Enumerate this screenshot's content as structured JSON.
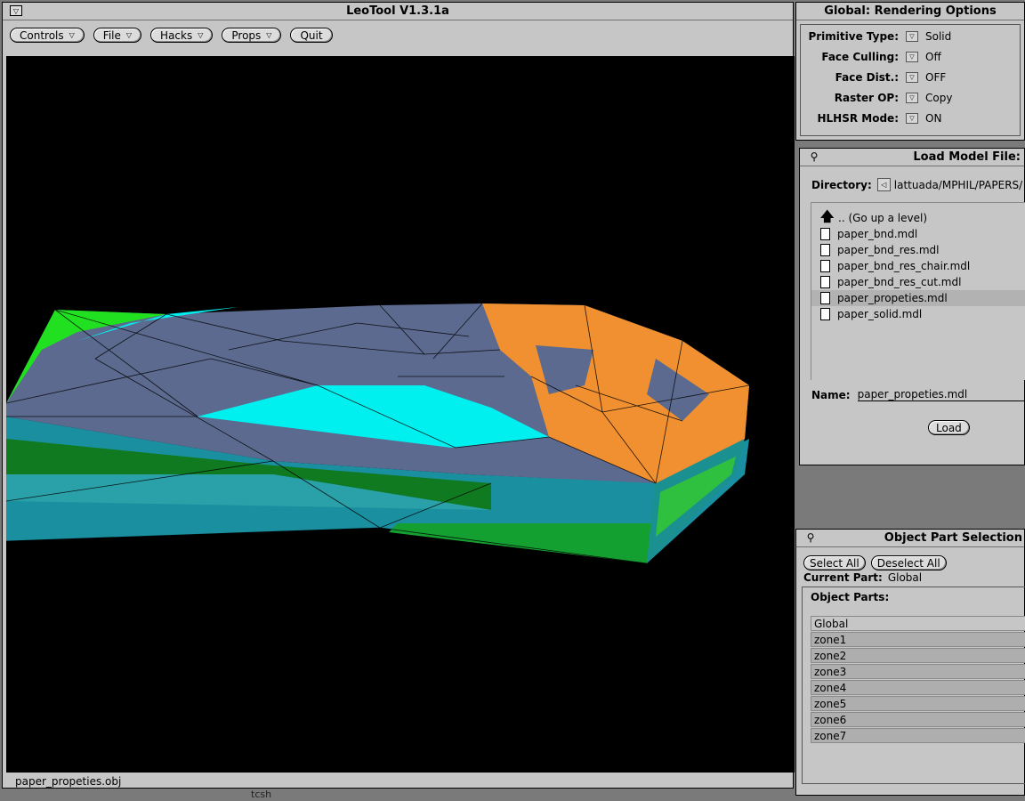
{
  "main_window": {
    "title": "LeoTool V1.3.1a",
    "menus": [
      {
        "label": "Controls",
        "has_menu": true
      },
      {
        "label": "File",
        "has_menu": true
      },
      {
        "label": "Hacks",
        "has_menu": true
      },
      {
        "label": "Props",
        "has_menu": true
      },
      {
        "label": "Quit",
        "has_menu": false
      }
    ],
    "status_text": "paper_propeties.obj"
  },
  "rendering_options": {
    "title": "Global: Rendering Options",
    "options": [
      {
        "label": "Primitive Type:",
        "value": "Solid"
      },
      {
        "label": "Face Culling:",
        "value": "Off"
      },
      {
        "label": "Face Dist.:",
        "value": "OFF"
      },
      {
        "label": "Raster OP:",
        "value": "Copy"
      },
      {
        "label": "HLHSR Mode:",
        "value": "ON"
      }
    ]
  },
  "load_model": {
    "title": "Load Model File:",
    "directory_label": "Directory:",
    "directory_value": "lattuada/MPHIL/PAPERS/",
    "up_level_label": ".. (Go up a level)",
    "files": [
      "paper_bnd.mdl",
      "paper_bnd_res.mdl",
      "paper_bnd_res_chair.mdl",
      "paper_bnd_res_cut.mdl",
      "paper_propeties.mdl",
      "paper_solid.mdl"
    ],
    "selected_file": "paper_propeties.mdl",
    "name_label": "Name:",
    "name_value": "paper_propeties.mdl",
    "load_button": "Load"
  },
  "object_parts": {
    "title": "Object Part Selection",
    "select_all": "Select All",
    "deselect_all": "Deselect All",
    "current_part_label": "Current Part:",
    "current_part_value": "Global",
    "parts_label": "Object Parts:",
    "parts": [
      "Global",
      "zone1",
      "zone2",
      "zone3",
      "zone4",
      "zone5",
      "zone6",
      "zone7"
    ]
  },
  "background_text": "tcsh",
  "colors": {
    "panel_bg": "#c6c6c6",
    "canvas_bg": "#000000",
    "mesh_slate": "#5c6a8f",
    "mesh_cyan": "#00f0f0",
    "mesh_orange": "#f09030",
    "mesh_green": "#20c020",
    "mesh_teal": "#1a8fa0"
  }
}
